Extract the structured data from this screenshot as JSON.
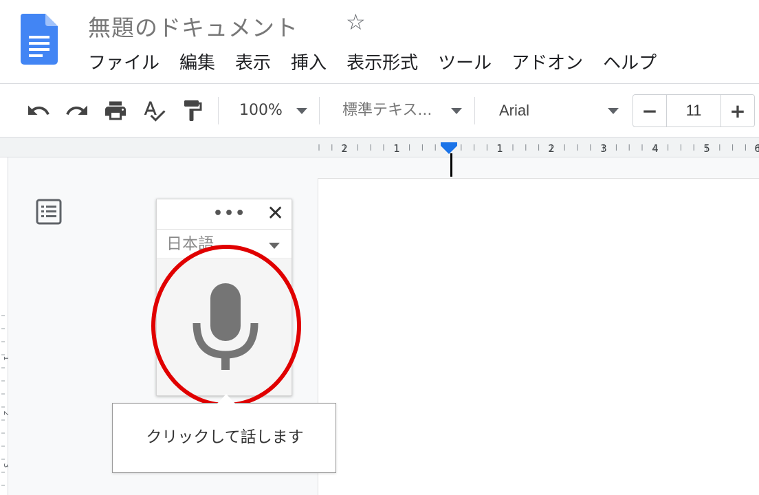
{
  "header": {
    "doc_title": "無題のドキュメント",
    "star_icon": "star-outline-icon",
    "logo_icon": "google-docs-logo-icon",
    "logo_color": "#4285F4"
  },
  "menu": {
    "items": [
      {
        "label": "ファイル"
      },
      {
        "label": "編集"
      },
      {
        "label": "表示"
      },
      {
        "label": "挿入"
      },
      {
        "label": "表示形式"
      },
      {
        "label": "ツール"
      },
      {
        "label": "アドオン"
      },
      {
        "label": "ヘルプ"
      }
    ]
  },
  "toolbar": {
    "icons": [
      "undo-icon",
      "redo-icon",
      "print-icon",
      "spellcheck-icon",
      "paint-format-icon"
    ],
    "zoom": "100%",
    "style": "標準テキス...",
    "font": "Arial",
    "font_size": "11",
    "decrease_label": "−",
    "increase_label": "+"
  },
  "ruler": {
    "labels": [
      "2",
      "1",
      "1",
      "2",
      "3",
      "4",
      "5",
      "6"
    ],
    "indent_marker_color": "#1a73e8"
  },
  "vertical_ruler": {
    "labels": [
      "1",
      "2",
      "3"
    ]
  },
  "voice_typing": {
    "more_icon": "more-horizontal-icon",
    "more_label": "•••",
    "close_icon": "close-icon",
    "close_label": "✕",
    "language": "日本語",
    "mic_icon": "microphone-icon",
    "mic_color": "#757575",
    "highlight_color": "#e00000"
  },
  "tooltip": {
    "text": "クリックして話します"
  }
}
